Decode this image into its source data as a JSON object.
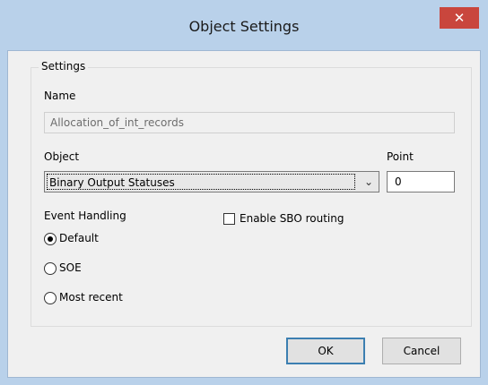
{
  "window": {
    "title": "Object Settings",
    "close_glyph": "✕"
  },
  "settings": {
    "group_label": "Settings",
    "name_label": "Name",
    "name_value": "Allocation_of_int_records",
    "object_label": "Object",
    "object_value": "Binary Output Statuses",
    "point_label": "Point",
    "point_value": "0",
    "event_handling_label": "Event Handling",
    "event_options": [
      {
        "label": "Default",
        "selected": true
      },
      {
        "label": "SOE",
        "selected": false
      },
      {
        "label": "Most recent",
        "selected": false
      }
    ],
    "sbo_label": "Enable SBO routing",
    "sbo_checked": false
  },
  "buttons": {
    "ok": "OK",
    "cancel": "Cancel"
  },
  "colors": {
    "titlebar": "#b9d1ea",
    "close_button": "#c9463d",
    "dialog_bg": "#f0f0f0"
  }
}
